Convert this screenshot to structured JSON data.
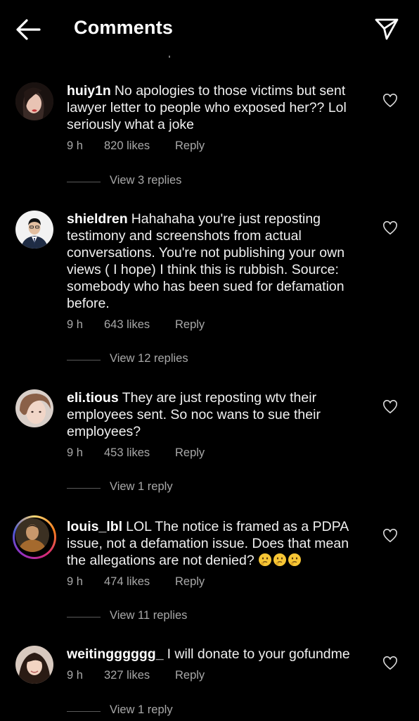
{
  "header": {
    "title": "Comments",
    "back_icon": "arrow-left-icon",
    "share_icon": "send-paper-plane-icon"
  },
  "comments": [
    {
      "username": "huiy1n",
      "text": "No apologies to those victims but sent lawyer letter to people who exposed her?? Lol seriously what a joke",
      "time": "9 h",
      "likes": "820 likes",
      "reply_label": "Reply",
      "view_replies": "View 3 replies"
    },
    {
      "username": "shieldren",
      "text": "Hahahaha you're just reposting testimony and screenshots from actual conversations. You're not publishing your own views ( I hope) I think this is rubbish. Source: somebody who has been sued for defamation before.",
      "time": "9 h",
      "likes": "643 likes",
      "reply_label": "Reply",
      "view_replies": "View 12 replies"
    },
    {
      "username": "eli.tious",
      "text": "They are just reposting wtv their employees sent. So noc wans to sue their employees?",
      "time": "9 h",
      "likes": "453 likes",
      "reply_label": "Reply",
      "view_replies": "View 1 reply"
    },
    {
      "username": "louis_lbl",
      "text": "LOL The notice is framed as a PDPA issue, not a defamation issue. Does that mean the allegations are not denied?",
      "emojis": [
        "thinking-face-emoji",
        "thinking-face-emoji",
        "thinking-face-emoji"
      ],
      "time": "9 h",
      "likes": "474 likes",
      "reply_label": "Reply",
      "view_replies": "View 11 replies"
    },
    {
      "username": "weitingggggg_",
      "text": "I will donate to your gofundme",
      "time": "9 h",
      "likes": "327 likes",
      "reply_label": "Reply",
      "view_replies": "View 1 reply"
    }
  ]
}
